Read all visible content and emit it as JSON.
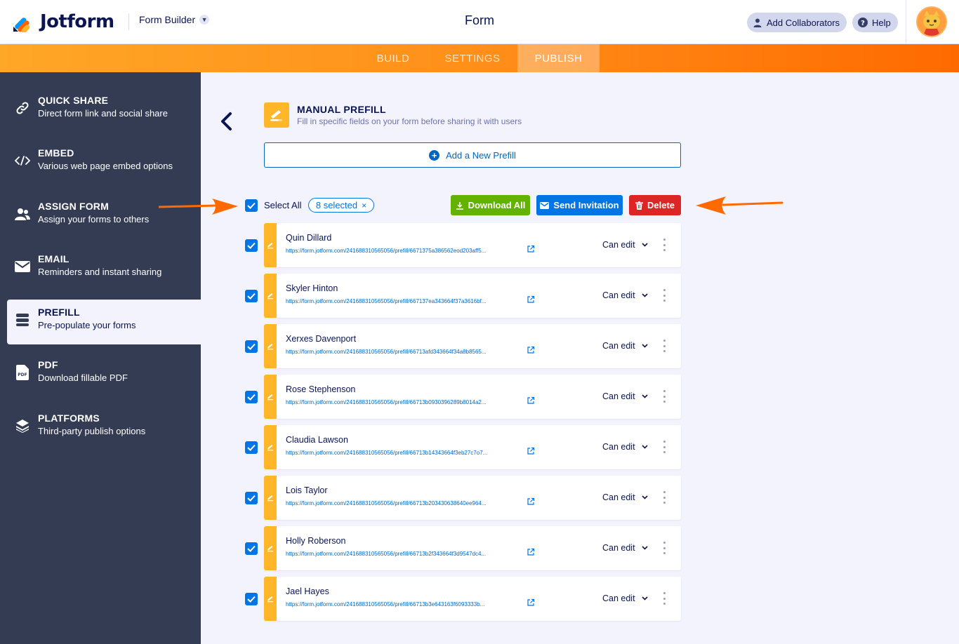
{
  "header": {
    "brand": "Jotform",
    "builder_label": "Form Builder",
    "title": "Form",
    "collab_label": "Add Collaborators",
    "help_label": "Help"
  },
  "tabs": [
    {
      "label": "BUILD",
      "active": false
    },
    {
      "label": "SETTINGS",
      "active": false
    },
    {
      "label": "PUBLISH",
      "active": true
    }
  ],
  "sidebar": {
    "items": [
      {
        "title": "QUICK SHARE",
        "subtitle": "Direct form link and social share",
        "icon": "link-icon"
      },
      {
        "title": "EMBED",
        "subtitle": "Various web page embed options",
        "icon": "code-icon"
      },
      {
        "title": "ASSIGN FORM",
        "subtitle": "Assign your forms to others",
        "icon": "users-icon"
      },
      {
        "title": "EMAIL",
        "subtitle": "Reminders and instant sharing",
        "icon": "envelope-icon"
      },
      {
        "title": "PREFILL",
        "subtitle": "Pre-populate your forms",
        "icon": "prefill-icon",
        "active": true
      },
      {
        "title": "PDF",
        "subtitle": "Download fillable PDF",
        "icon": "pdf-icon"
      },
      {
        "title": "PLATFORMS",
        "subtitle": "Third-party publish options",
        "icon": "layers-icon"
      }
    ]
  },
  "main": {
    "section_title": "MANUAL PREFILL",
    "section_desc": "Fill in specific fields on your form before sharing it with users",
    "add_label": "Add a New Prefill",
    "select_all_label": "Select All",
    "selected_label": "8 selected",
    "selected_clear": "×",
    "download_label": "Download All",
    "invite_label": "Send Invitation",
    "delete_label": "Delete"
  },
  "prefills": [
    {
      "name": "Quin Dillard",
      "url": "https://form.jotform.com/241688310565056/prefill/6671375a386562eod203aff5...",
      "permission": "Can edit",
      "checked": true
    },
    {
      "name": "Skyler Hinton",
      "url": "https://form.jotform.com/241688310565056/prefill/667137ea343664f37a3616bf...",
      "permission": "Can edit",
      "checked": true
    },
    {
      "name": "Xerxes Davenport",
      "url": "https://form.jotform.com/241688310565056/prefill/66713afd343664f34a8b8565...",
      "permission": "Can edit",
      "checked": true
    },
    {
      "name": "Rose Stephenson",
      "url": "https://form.jotform.com/241688310565056/prefill/66713b0930396289b8014a2...",
      "permission": "Can edit",
      "checked": true
    },
    {
      "name": "Claudia Lawson",
      "url": "https://form.jotform.com/241688310565056/prefill/66713b14343664f3eb27c7o7...",
      "permission": "Can edit",
      "checked": true
    },
    {
      "name": "Lois Taylor",
      "url": "https://form.jotform.com/241688310565056/prefill/66713b203430638640ee964...",
      "permission": "Can edit",
      "checked": true
    },
    {
      "name": "Holly Roberson",
      "url": "https://form.jotform.com/241688310565056/prefill/66713b2f343664f3d9547dc4...",
      "permission": "Can edit",
      "checked": true
    },
    {
      "name": "Jael Hayes",
      "url": "https://form.jotform.com/241688310565056/prefill/66713b3e643163f6093333b...",
      "permission": "Can edit",
      "checked": true
    }
  ],
  "colors": {
    "accent_orange": "#ff6100",
    "prefill_yellow": "#ffb629",
    "download_green": "#64b200",
    "invite_blue": "#0075e3",
    "delete_red": "#dc2626",
    "sidebar_bg": "#343c54"
  }
}
